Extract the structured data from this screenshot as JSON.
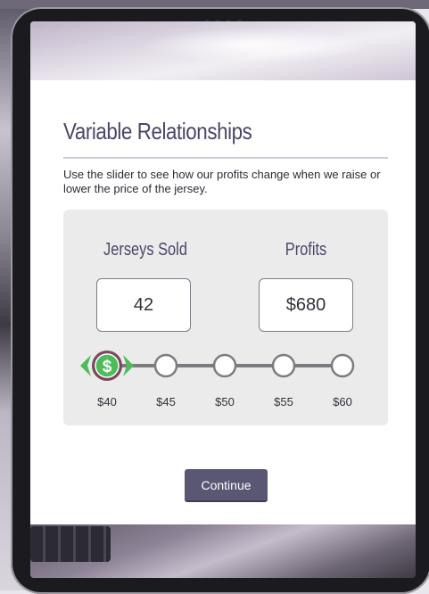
{
  "dialog": {
    "title": "Variable Relationships",
    "description": "Use the slider to see how our profits change when we raise or lower the price of the jersey."
  },
  "panel": {
    "jerseys_label": "Jerseys Sold",
    "profits_label": "Profits",
    "jerseys_value": "42",
    "profits_value": "$680"
  },
  "slider": {
    "handle_symbol": "$",
    "selected_index": 0,
    "ticks": [
      "$40",
      "$45",
      "$50",
      "$55",
      "$60"
    ]
  },
  "continue_label": "Continue",
  "colors": {
    "title": "#4d4667",
    "handle_green": "#4cbb5a",
    "handle_ring": "#7a4a5c",
    "track": "#7d7b80",
    "button": "#5a5775"
  }
}
